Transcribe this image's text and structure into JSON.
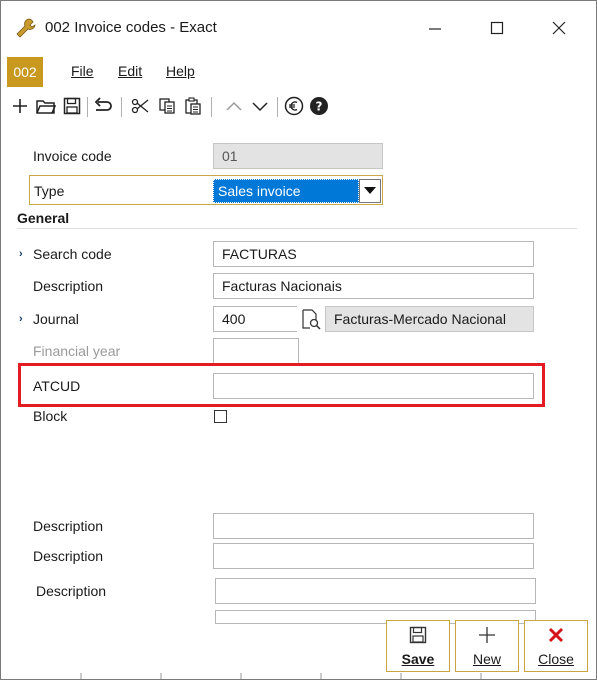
{
  "window": {
    "title": "002 Invoice codes - Exact",
    "app_badge": "002",
    "icon": "wrench-icon",
    "controls": [
      "minimize-icon",
      "maximize-icon",
      "close-icon"
    ]
  },
  "menu": {
    "file": "File",
    "edit": "Edit",
    "help": "Help"
  },
  "toolbar": {
    "icons": [
      "plus-icon",
      "open-folder-icon",
      "save-icon",
      "undo-icon",
      "cut-icon",
      "copy-icon",
      "paste-icon",
      "up-icon",
      "down-icon",
      "euro-icon",
      "help-icon"
    ]
  },
  "form": {
    "invoice_code_label": "Invoice code",
    "invoice_code_value": "01",
    "type_label": "Type",
    "type_value": "Sales invoice",
    "section_general": "General",
    "search_code_label": "Search code",
    "search_code_value": "FACTURAS",
    "description_label": "Description",
    "description_value": "Facturas Nacionais",
    "journal_label": "Journal",
    "journal_code": "400",
    "journal_name": "Facturas-Mercado Nacional",
    "financial_year_label": "Financial year",
    "financial_year_value": "",
    "atcud_label": "ATCUD",
    "atcud_value": "",
    "block_label": "Block",
    "extra_desc_1_label": "Description",
    "extra_desc_2_label": "Description",
    "extra_desc_3_label": "Description"
  },
  "buttons": {
    "save": "Save",
    "new": "New",
    "close": "Close"
  },
  "colors": {
    "highlight": "#e31b23",
    "selected": "#0078d7",
    "badge": "#c8981f"
  }
}
